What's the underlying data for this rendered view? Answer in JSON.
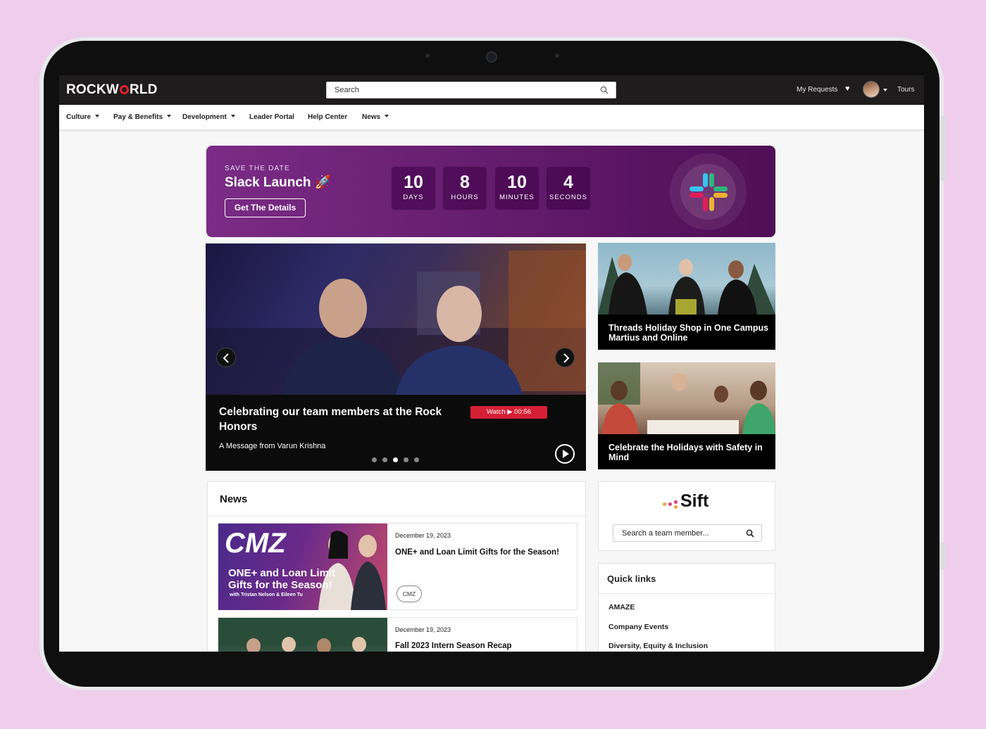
{
  "topbar": {
    "logo": "ROCKWORLD",
    "search_placeholder": "Search",
    "my_requests": "My Requests",
    "tours": "Tours"
  },
  "nav": {
    "items": [
      {
        "label": "Culture",
        "dropdown": true
      },
      {
        "label": "Pay & Benefits",
        "dropdown": true
      },
      {
        "label": "Development",
        "dropdown": true
      },
      {
        "label": "Leader Portal",
        "dropdown": false
      },
      {
        "label": "Help Center",
        "dropdown": false
      },
      {
        "label": "News",
        "dropdown": true
      }
    ]
  },
  "banner": {
    "eyebrow": "SAVE THE DATE",
    "title": "Slack Launch 🚀",
    "button": "Get The Details",
    "countdown": [
      {
        "value": "10",
        "label": "DAYS"
      },
      {
        "value": "8",
        "label": "HOURS"
      },
      {
        "value": "10",
        "label": "MINUTES"
      },
      {
        "value": "4",
        "label": "SECONDS"
      }
    ]
  },
  "hero": {
    "title": "Celebrating our team members at the Rock Honors",
    "watch_label": "Watch ▶ 00:56",
    "subtitle": "A Message from Varun Krishna",
    "active_slide": 3,
    "slide_count": 5
  },
  "side_cards": [
    {
      "title": "Threads Holiday Shop in One Campus Martius and Online"
    },
    {
      "title": "Celebrate the Holidays with Safety in Mind"
    }
  ],
  "news": {
    "heading": "News",
    "items": [
      {
        "date": "December 19, 2023",
        "headline": "ONE+ and Loan Limit Gifts for the Season!",
        "tag": "CMZ",
        "thumb_text": {
          "brand": "CMZ",
          "line1": "ONE+ and Loan Limit",
          "line2": "Gifts for the Season!",
          "line3": "with Tristan Nelson & Eileen Tu"
        }
      },
      {
        "date": "December 19, 2023",
        "headline": "Fall 2023 Intern Season Recap",
        "tag": ""
      }
    ]
  },
  "sift": {
    "logo": "Sift",
    "search_placeholder": "Search a team member..."
  },
  "quick_links": {
    "heading": "Quick links",
    "items": [
      "AMAZE",
      "Company Events",
      "Diversity, Equity & Inclusion"
    ]
  },
  "colors": {
    "accent_red": "#d51f35",
    "banner_purple": "#6a1f73",
    "topbar": "#1f1c1d",
    "page_bg": "#efcdec"
  }
}
